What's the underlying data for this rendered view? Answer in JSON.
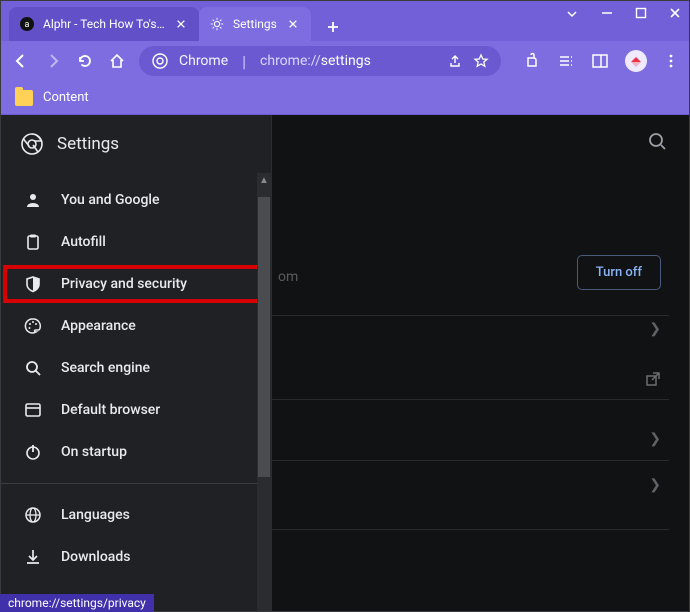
{
  "tabs": [
    {
      "title": "Alphr - Tech How To's & G",
      "favicon": "alphr"
    },
    {
      "title": "Settings",
      "favicon": "gear"
    }
  ],
  "omnibox": {
    "host": "Chrome",
    "path_prefix": "chrome://",
    "path_bold": "settings"
  },
  "bookmarks": {
    "item0": "Content"
  },
  "header": {
    "title": "Settings"
  },
  "sidebar": {
    "items": [
      {
        "label": "You and Google"
      },
      {
        "label": "Autofill"
      },
      {
        "label": "Privacy and security"
      },
      {
        "label": "Appearance"
      },
      {
        "label": "Search engine"
      },
      {
        "label": "Default browser"
      },
      {
        "label": "On startup"
      },
      {
        "label": "Languages"
      },
      {
        "label": "Downloads"
      }
    ]
  },
  "main": {
    "partial_text": "om",
    "turn_off": "Turn off"
  },
  "statusbar": {
    "text": "chrome://settings/privacy"
  }
}
